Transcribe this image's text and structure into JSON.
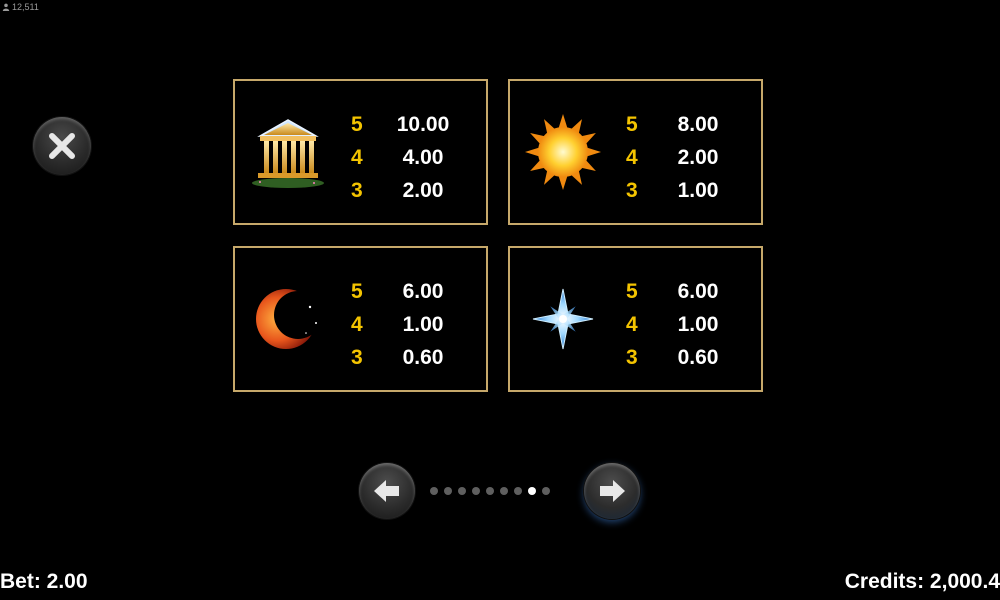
{
  "header": {
    "player_count": "12,511",
    "player_icon": "person-icon"
  },
  "close_button": {
    "icon": "close-icon"
  },
  "paytable": [
    {
      "symbol": "temple",
      "payouts": [
        {
          "count": "5",
          "amount": "10.00"
        },
        {
          "count": "4",
          "amount": "4.00"
        },
        {
          "count": "3",
          "amount": "2.00"
        }
      ]
    },
    {
      "symbol": "sun",
      "payouts": [
        {
          "count": "5",
          "amount": "8.00"
        },
        {
          "count": "4",
          "amount": "2.00"
        },
        {
          "count": "3",
          "amount": "1.00"
        }
      ]
    },
    {
      "symbol": "moon",
      "payouts": [
        {
          "count": "5",
          "amount": "6.00"
        },
        {
          "count": "4",
          "amount": "1.00"
        },
        {
          "count": "3",
          "amount": "0.60"
        }
      ]
    },
    {
      "symbol": "star",
      "payouts": [
        {
          "count": "5",
          "amount": "6.00"
        },
        {
          "count": "4",
          "amount": "1.00"
        },
        {
          "count": "3",
          "amount": "0.60"
        }
      ]
    }
  ],
  "pagination": {
    "total_pages": 9,
    "current_page": 8
  },
  "footer": {
    "bet": "Bet: 2.00",
    "credits": "Credits: 2,000.4"
  },
  "colors": {
    "card_border": "#c6a86a",
    "count_color": "#f4c400",
    "background": "#000000"
  }
}
